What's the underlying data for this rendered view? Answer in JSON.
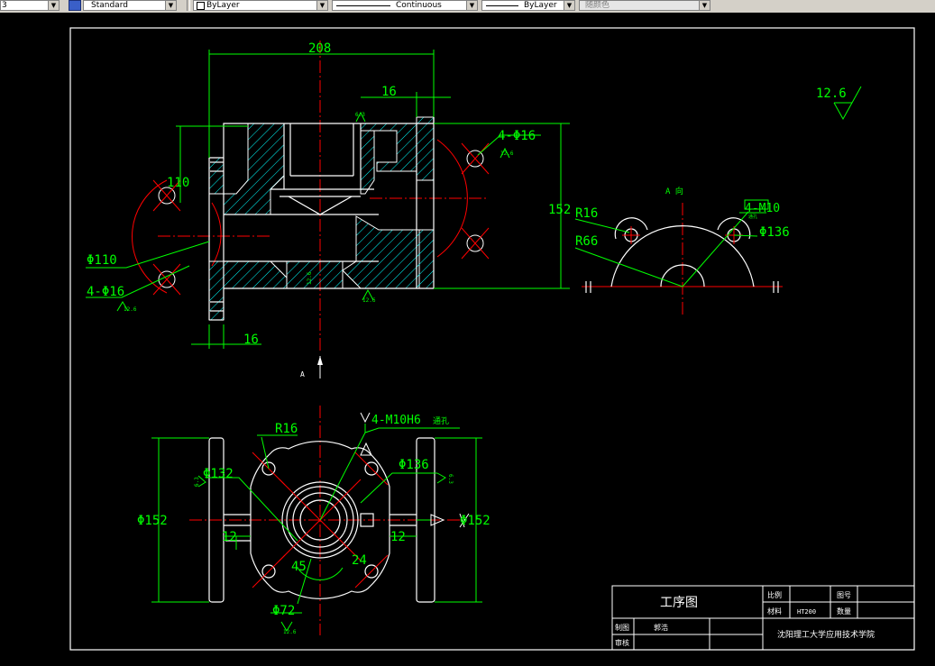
{
  "toolbar": {
    "textstyle_fragment": "3",
    "text_style": "Standard",
    "layer": "ByLayer",
    "linetype": "Continuous",
    "lineweight": "ByLayer",
    "plotstyle": "随颜色"
  },
  "front_view": {
    "dim_width": "208",
    "dim_flange": "16",
    "dim_bottom": "16",
    "dim_110": "110",
    "dim_152": "152",
    "dim_holes": "4-Φ16",
    "dim_holes_left": "4-Φ16",
    "dim_phi110": "Φ110",
    "rough_63": "6.3",
    "rough_126_a": "12.6",
    "rough_126_b": "12.6",
    "rough_126_c": "12.6",
    "rough_126_d": "12.6",
    "section_label": "A"
  },
  "side_view": {
    "title": "A  向",
    "r16": "R16",
    "r66": "R66",
    "thread": "4-M10",
    "thread_sub": "通孔",
    "phi136": "Φ136"
  },
  "roughness_global": "12.6",
  "top_view": {
    "thread_callout": "4-M10H6",
    "thread_suffix": "通孔",
    "r16": "R16",
    "phi132": "Φ132",
    "phi136": "Φ136",
    "phi152_left": "Φ152",
    "phi152_right": "Φ152",
    "dim_12_left": "12",
    "dim_12_right": "12",
    "angle45": "45",
    "dim24": "24",
    "phi72": "Φ72",
    "rough_63": "6.3",
    "rough_126": "12.6",
    "rough_63_right": "6.3"
  },
  "title_block": {
    "title": "工序图",
    "scale_label": "比例",
    "drawing_no_label": "图号",
    "material_label": "材料",
    "material_value": "HT200",
    "qty_label": "数量",
    "drawn_label": "制图",
    "drawn_name": "郭浩",
    "checked_label": "审核",
    "school": "沈阳理工大学应用技术学院"
  },
  "colors": {
    "background": "#000000",
    "outline": "#ffffff",
    "dimension": "#00ff00",
    "centerline": "#ff0000",
    "hatch": "#00ffff"
  }
}
